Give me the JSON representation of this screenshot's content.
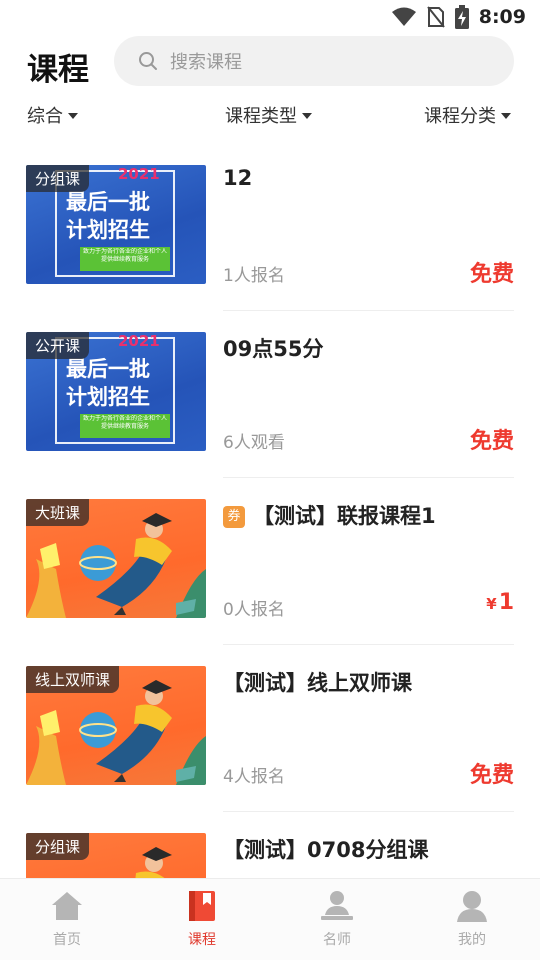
{
  "status_bar": {
    "time": "8:09"
  },
  "header": {
    "title": "课程",
    "search_placeholder": "搜索课程"
  },
  "filters": [
    {
      "label": "综合"
    },
    {
      "label": "课程类型"
    },
    {
      "label": "课程分类"
    }
  ],
  "courses": [
    {
      "tag": "分组课",
      "title": "12",
      "meta": "1人报名",
      "price": "免费",
      "theme": "blue",
      "coupon": ""
    },
    {
      "tag": "公开课",
      "title": "09点55分",
      "meta": "6人观看",
      "price": "免费",
      "theme": "blue",
      "coupon": ""
    },
    {
      "tag": "大班课",
      "title": "【测试】联报课程1",
      "meta": "0人报名",
      "price_symbol": "¥",
      "price": "1",
      "theme": "orange",
      "coupon": "券"
    },
    {
      "tag": "线上双师课",
      "title": "【测试】线上双师课",
      "meta": "4人报名",
      "price": "免费",
      "theme": "orange",
      "coupon": ""
    },
    {
      "tag": "分组课",
      "title": "【测试】0708分组课",
      "meta": "",
      "price": "",
      "theme": "orange",
      "coupon": ""
    }
  ],
  "thumb_poster": {
    "year": "2021",
    "line1": "最后一批",
    "line2": "计划招生",
    "note": "致力于为各行各业的企业和个人提供继续教育服务"
  },
  "tabbar": [
    {
      "label": "首页",
      "icon": "home-icon",
      "active": false
    },
    {
      "label": "课程",
      "icon": "book-icon",
      "active": true
    },
    {
      "label": "名师",
      "icon": "teacher-icon",
      "active": false
    },
    {
      "label": "我的",
      "icon": "profile-icon",
      "active": false
    }
  ],
  "colors": {
    "accent": "#ee3a2f",
    "search_bg": "#f1f1f1",
    "coupon": "#f39a3d"
  }
}
